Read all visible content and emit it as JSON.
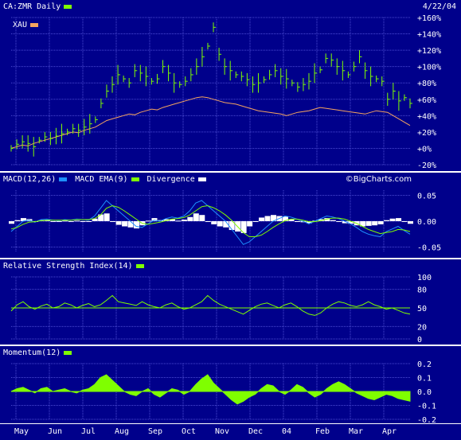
{
  "header": {
    "symbol_label": "CA:ZMR Daily",
    "compare_label": "XAU",
    "date": "4/22/04",
    "watermark": "©BigCharts.com"
  },
  "colors": {
    "background": "#00008b",
    "grid": "#4b4bd2",
    "price": "#7fff00",
    "xau": "#f4a460",
    "macd": "#1e90ff",
    "macd_ema": "#7fff00",
    "divergence": "#ffffff",
    "rsi": "#7fff00",
    "momentum": "#7fff00"
  },
  "chart_data": [
    {
      "type": "line",
      "name": "price",
      "title": "CA:ZMR Daily",
      "y_ticks": [
        "+160%",
        "+140%",
        "+120%",
        "+100%",
        "+80%",
        "+60%",
        "+40%",
        "+20%",
        "+0%",
        "-20%"
      ],
      "ylim": [
        -20,
        160
      ],
      "x_months": [
        "May",
        "Jun",
        "Jul",
        "Aug",
        "Sep",
        "Oct",
        "Nov",
        "Dec",
        "04",
        "Feb",
        "Mar",
        "Apr"
      ],
      "series": [
        {
          "name": "CA:ZMR Daily",
          "values": [
            0,
            5,
            8,
            6,
            2,
            10,
            14,
            12,
            15,
            18,
            20,
            24,
            22,
            26,
            30,
            35,
            55,
            70,
            78,
            90,
            85,
            80,
            95,
            92,
            88,
            82,
            85,
            100,
            92,
            80,
            78,
            82,
            90,
            100,
            112,
            125,
            148,
            115,
            100,
            95,
            90,
            88,
            84,
            78,
            80,
            84,
            90,
            95,
            88,
            85,
            80,
            75,
            78,
            82,
            92,
            96,
            110,
            108,
            100,
            95,
            90,
            100,
            112,
            95,
            88,
            85,
            82,
            60,
            70,
            58,
            62,
            55
          ]
        },
        {
          "name": "XAU",
          "values": [
            0,
            2,
            4,
            3,
            6,
            8,
            10,
            12,
            14,
            16,
            18,
            20,
            19,
            22,
            24,
            26,
            30,
            34,
            36,
            38,
            40,
            42,
            41,
            44,
            46,
            48,
            47,
            50,
            52,
            54,
            56,
            58,
            60,
            62,
            63,
            62,
            60,
            58,
            56,
            55,
            54,
            52,
            50,
            48,
            46,
            45,
            44,
            43,
            42,
            40,
            42,
            44,
            45,
            46,
            48,
            50,
            49,
            48,
            47,
            46,
            45,
            44,
            43,
            42,
            44,
            46,
            45,
            44,
            40,
            36,
            32,
            28
          ]
        }
      ]
    },
    {
      "type": "line",
      "name": "macd",
      "title": "MACD(12,26)",
      "legend": [
        "MACD(12,26)",
        "MACD EMA(9)",
        "Divergence"
      ],
      "y_ticks": [
        "0.05",
        "0.00",
        "-0.05"
      ],
      "ylim": [
        -0.06,
        0.06
      ],
      "series": [
        {
          "name": "MACD(12,26)",
          "values": [
            -0.02,
            -0.01,
            0.0,
            0.002,
            -0.002,
            0.003,
            0.004,
            0.002,
            0.001,
            0.003,
            0.002,
            0.004,
            0.003,
            0.002,
            0.01,
            0.025,
            0.04,
            0.03,
            0.02,
            0.01,
            0.0,
            -0.01,
            -0.012,
            -0.005,
            0.002,
            0.0,
            0.005,
            0.008,
            0.006,
            0.01,
            0.02,
            0.035,
            0.04,
            0.03,
            0.02,
            0.01,
            0.0,
            -0.015,
            -0.03,
            -0.045,
            -0.04,
            -0.03,
            -0.02,
            -0.01,
            0.0,
            0.005,
            0.01,
            0.008,
            0.004,
            0.0,
            -0.005,
            0.0,
            0.005,
            0.01,
            0.008,
            0.005,
            0.0,
            -0.005,
            -0.012,
            -0.02,
            -0.025,
            -0.028,
            -0.03,
            -0.02,
            -0.015,
            -0.01,
            -0.018,
            -0.025
          ]
        },
        {
          "name": "MACD EMA(9)",
          "values": [
            -0.015,
            -0.012,
            -0.006,
            -0.002,
            -0.001,
            0.001,
            0.002,
            0.002,
            0.002,
            0.002,
            0.002,
            0.003,
            0.003,
            0.003,
            0.005,
            0.012,
            0.025,
            0.03,
            0.027,
            0.02,
            0.012,
            0.004,
            -0.004,
            -0.006,
            -0.004,
            -0.002,
            0.001,
            0.004,
            0.005,
            0.007,
            0.012,
            0.02,
            0.028,
            0.03,
            0.026,
            0.02,
            0.012,
            0.002,
            -0.01,
            -0.022,
            -0.03,
            -0.03,
            -0.027,
            -0.02,
            -0.012,
            -0.005,
            0.001,
            0.004,
            0.004,
            0.002,
            -0.001,
            -0.001,
            0.001,
            0.004,
            0.006,
            0.006,
            0.004,
            0.0,
            -0.004,
            -0.01,
            -0.016,
            -0.02,
            -0.024,
            -0.022,
            -0.02,
            -0.016,
            -0.017,
            -0.02
          ]
        }
      ]
    },
    {
      "type": "line",
      "name": "rsi",
      "title": "Relative Strength Index(14)",
      "y_ticks": [
        "100",
        "80",
        "50",
        "20",
        "0"
      ],
      "ylim": [
        0,
        100
      ],
      "series": [
        {
          "name": "Relative Strength Index(14)",
          "values": [
            45,
            55,
            60,
            52,
            48,
            53,
            56,
            50,
            52,
            58,
            55,
            50,
            54,
            57,
            52,
            55,
            62,
            70,
            60,
            58,
            56,
            54,
            60,
            55,
            52,
            50,
            55,
            58,
            52,
            48,
            50,
            55,
            60,
            70,
            62,
            56,
            52,
            48,
            44,
            40,
            46,
            52,
            56,
            58,
            54,
            50,
            55,
            58,
            52,
            45,
            40,
            38,
            42,
            50,
            56,
            60,
            58,
            54,
            52,
            55,
            60,
            55,
            52,
            48,
            50,
            46,
            42,
            40
          ]
        }
      ]
    },
    {
      "type": "area",
      "name": "momentum",
      "title": "Momentum(12)",
      "y_ticks": [
        "0.2",
        "0.1",
        "0.0",
        "-0.1",
        "-0.2"
      ],
      "ylim": [
        -0.2,
        0.2
      ],
      "series": [
        {
          "name": "Momentum(12)",
          "values": [
            0.0,
            0.02,
            0.03,
            0.01,
            -0.01,
            0.02,
            0.03,
            0.0,
            0.01,
            0.02,
            0.0,
            -0.01,
            0.01,
            0.02,
            0.05,
            0.1,
            0.12,
            0.08,
            0.04,
            0.0,
            -0.02,
            -0.03,
            0.0,
            0.02,
            -0.02,
            -0.04,
            -0.01,
            0.02,
            0.01,
            -0.02,
            0.0,
            0.05,
            0.09,
            0.12,
            0.06,
            0.02,
            -0.02,
            -0.06,
            -0.09,
            -0.07,
            -0.04,
            -0.02,
            0.02,
            0.05,
            0.04,
            0.0,
            -0.02,
            0.01,
            0.05,
            0.03,
            -0.01,
            -0.04,
            -0.02,
            0.02,
            0.05,
            0.07,
            0.05,
            0.02,
            -0.01,
            -0.03,
            -0.05,
            -0.06,
            -0.04,
            -0.02,
            -0.03,
            -0.05,
            -0.06,
            -0.07
          ]
        }
      ]
    }
  ]
}
